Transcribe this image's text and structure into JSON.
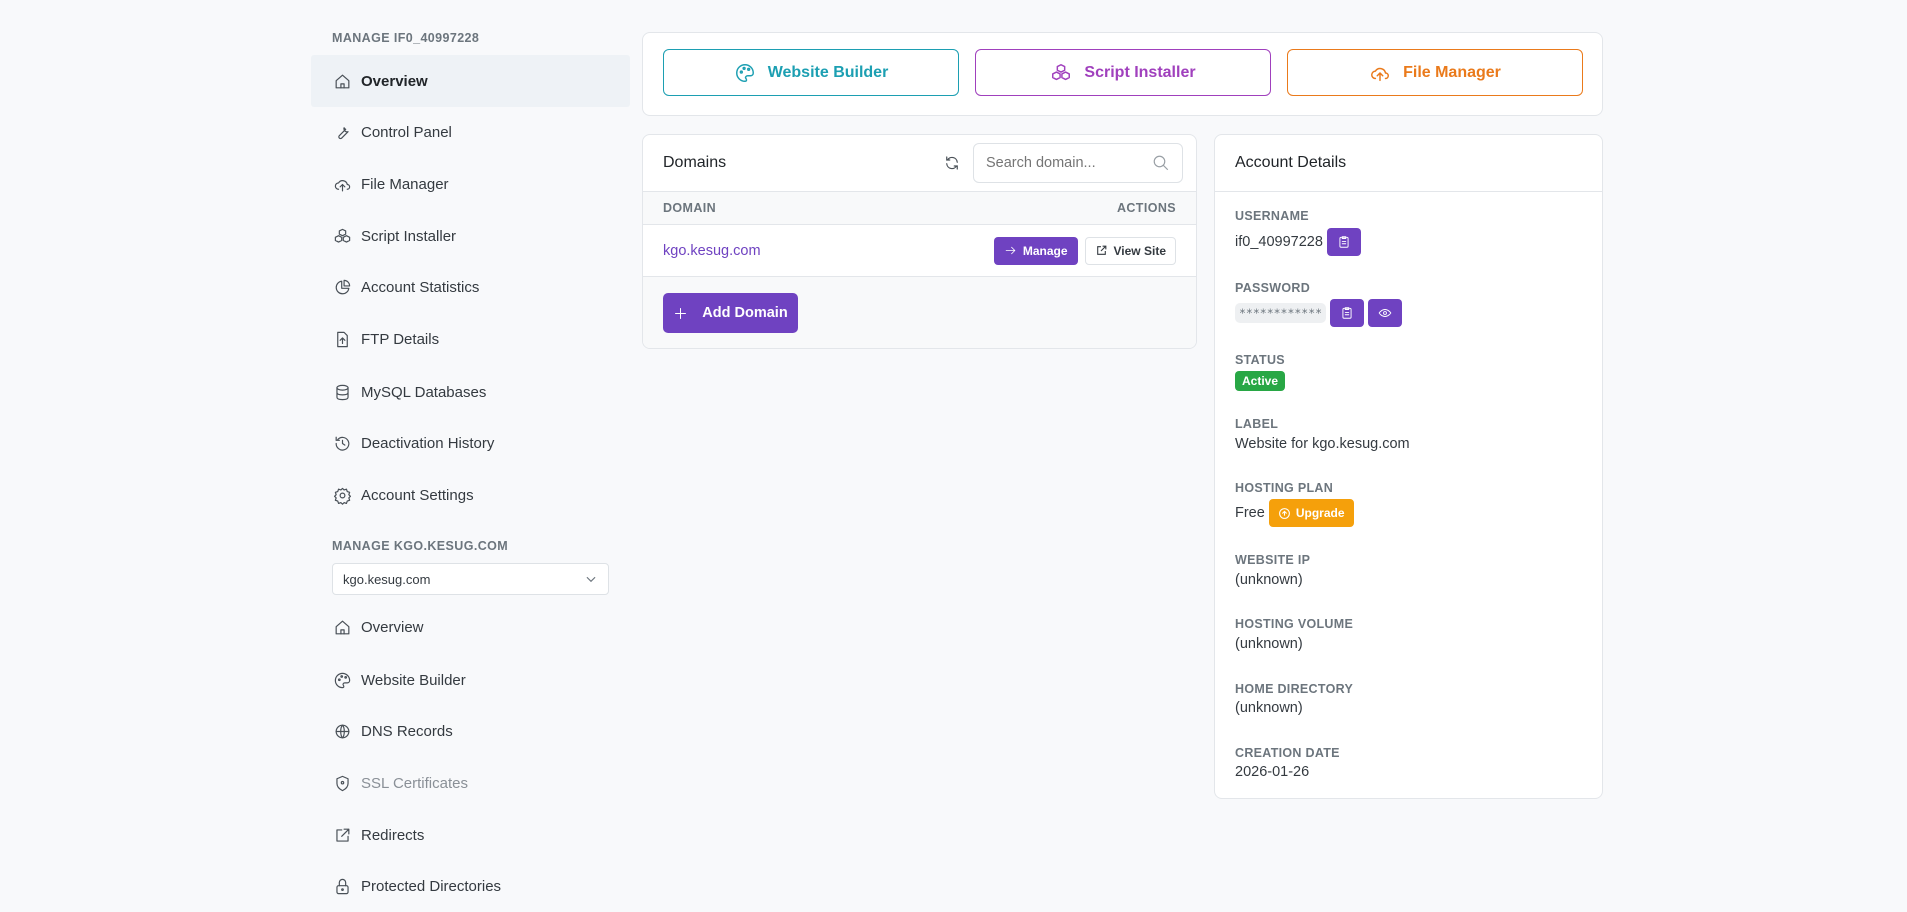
{
  "sidebar": {
    "section1_title": "MANAGE IF0_40997228",
    "items1": [
      {
        "label": "Overview"
      },
      {
        "label": "Control Panel"
      },
      {
        "label": "File Manager"
      },
      {
        "label": "Script Installer"
      },
      {
        "label": "Account Statistics"
      },
      {
        "label": "FTP Details"
      },
      {
        "label": "MySQL Databases"
      },
      {
        "label": "Deactivation History"
      },
      {
        "label": "Account Settings"
      }
    ],
    "section2_title": "MANAGE KGO.KESUG.COM",
    "domain_select": "kgo.kesug.com",
    "items2": [
      {
        "label": "Overview"
      },
      {
        "label": "Website Builder"
      },
      {
        "label": "DNS Records"
      },
      {
        "label": "SSL Certificates"
      },
      {
        "label": "Redirects"
      },
      {
        "label": "Protected Directories"
      }
    ]
  },
  "quick": {
    "website_builder": "Website Builder",
    "script_installer": "Script Installer",
    "file_manager": "File Manager"
  },
  "colors": {
    "accent": "#6f42c1",
    "teal": "#1c9fb2",
    "magenta": "#a040bd",
    "orange": "#ea7a1b",
    "success": "#28a745",
    "warning": "#f5a00b"
  },
  "domains": {
    "title": "Domains",
    "search_placeholder": "Search domain...",
    "col_domain": "DOMAIN",
    "col_actions": "ACTIONS",
    "rows": [
      {
        "domain": "kgo.kesug.com",
        "manage": "Manage",
        "view": "View Site"
      }
    ],
    "add": "Add Domain"
  },
  "account": {
    "title": "Account Details",
    "username_label": "USERNAME",
    "username": "if0_40997228",
    "password_label": "PASSWORD",
    "password": "************",
    "status_label": "STATUS",
    "status": "Active",
    "label_label": "LABEL",
    "label": "Website for kgo.kesug.com",
    "plan_label": "HOSTING PLAN",
    "plan": "Free",
    "upgrade": "Upgrade",
    "ip_label": "WEBSITE IP",
    "ip": "(unknown)",
    "volume_label": "HOSTING VOLUME",
    "volume": "(unknown)",
    "home_label": "HOME DIRECTORY",
    "home": "(unknown)",
    "created_label": "CREATION DATE",
    "created": "2026-01-26"
  }
}
